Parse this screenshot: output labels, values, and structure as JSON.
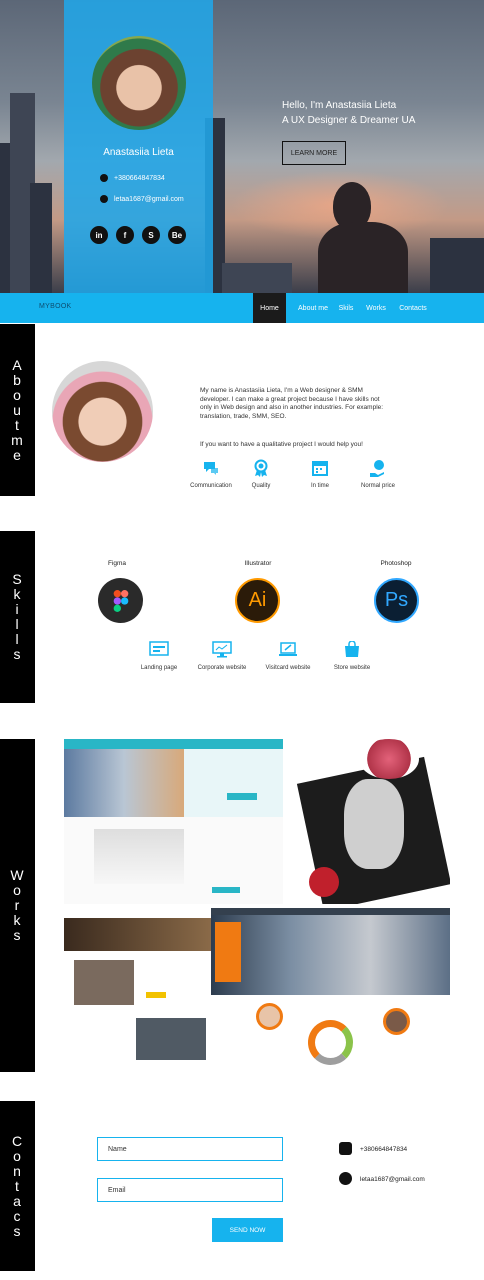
{
  "hero": {
    "name": "Anastasiia Lieta",
    "phone": "+380664847834",
    "email": "letaa1687@gmail.com",
    "title_line1": "Hello, I'm Anastasiia Lieta",
    "title_line2": "A UX Designer & Dreamer UA",
    "learn_more": "LEARN MORE",
    "social": [
      "in",
      "f",
      "S",
      "Be"
    ]
  },
  "nav": {
    "logo": "MYBOOK",
    "items": [
      "Home",
      "About me",
      "Skils",
      "Works",
      "Contacts"
    ],
    "active": "Home"
  },
  "about": {
    "label": "About me",
    "text": "My name is Anastasiia Lieta, I'm a Web designer & SMM developer. I can make a great project because I have skills not only in Web design and also in another industries. For example: translation, trade, SMM, SEO.",
    "text2": "If you want to have a qualitative project I would help you!",
    "features": [
      "Communication",
      "Quality",
      "In time",
      "Normal price"
    ]
  },
  "skills": {
    "label": "Skills",
    "tools": [
      "Figma",
      "Illustrator",
      "Photoshop"
    ],
    "websites": [
      "Landing page",
      "Corporate website",
      "Visitcard website",
      "Store website"
    ]
  },
  "works": {
    "label": "Works"
  },
  "contacts": {
    "label": "Contacs",
    "name_placeholder": "Name",
    "email_placeholder": "Email",
    "send": "SEND NOW",
    "phone": "+380664847834",
    "email": "letaa1687@gmail.com"
  },
  "colors": {
    "accent": "#16b3ee",
    "dark": "#000000"
  }
}
